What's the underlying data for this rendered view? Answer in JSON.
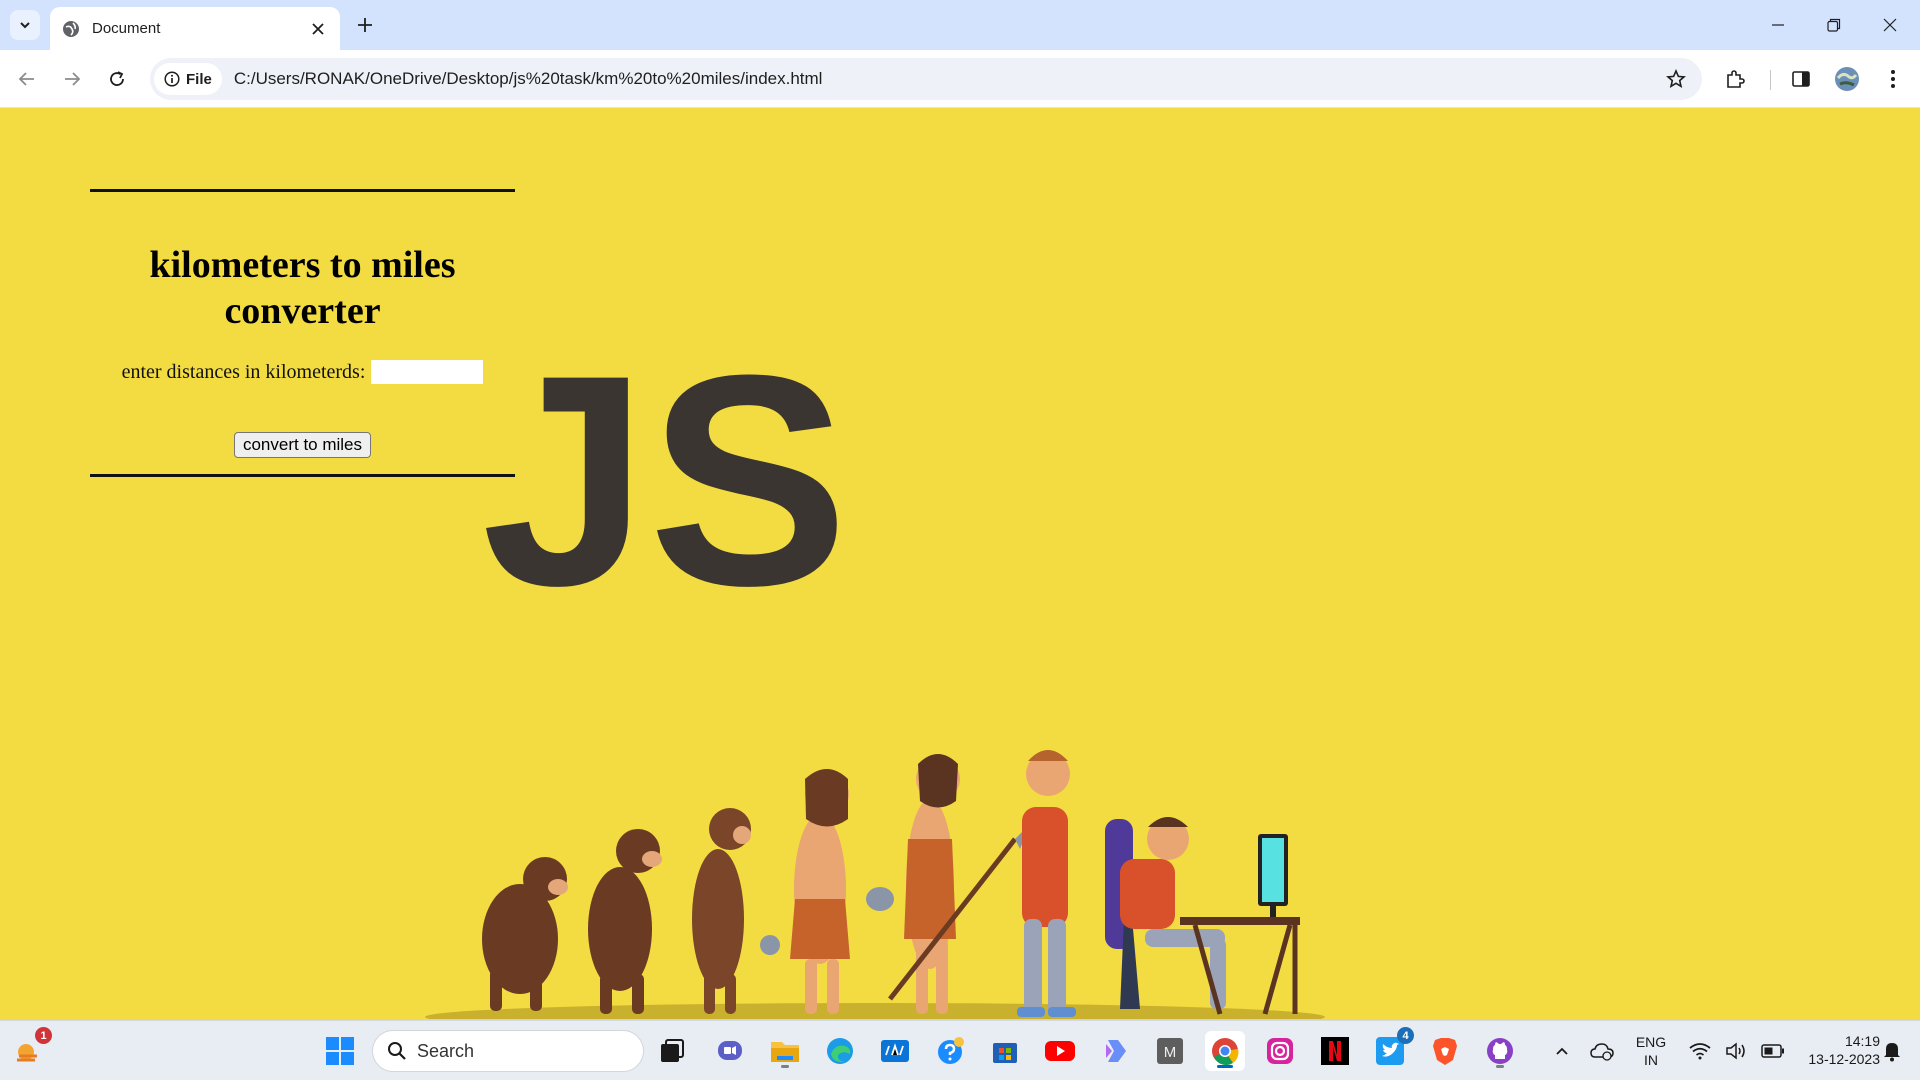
{
  "browser": {
    "tab_title": "Document",
    "url_chip": "File",
    "url": "C:/Users/RONAK/OneDrive/Desktop/js%20task/km%20to%20miles/index.html"
  },
  "page": {
    "heading": "kilometers to miles converter",
    "input_label": "enter distances in kilometerds:",
    "input_value": "",
    "button_label": "convert to miles",
    "hero_text": "JS",
    "background_color": "#f3dc41"
  },
  "taskbar": {
    "search_placeholder": "Search",
    "weather_badge": "1",
    "twitter_badge": "4",
    "language_line1": "ENG",
    "language_line2": "IN",
    "time": "14:19",
    "date": "13-12-2023",
    "apps": [
      "start-icon",
      "search",
      "task-view-icon",
      "teams-icon",
      "file-explorer-icon",
      "edge-icon",
      "myhp-icon",
      "help-icon",
      "store-icon",
      "youtube-icon",
      "copilot-icon",
      "m-app-icon",
      "chrome-icon",
      "instagram-icon",
      "netflix-icon",
      "twitter-icon",
      "brave-icon",
      "github-icon"
    ]
  }
}
